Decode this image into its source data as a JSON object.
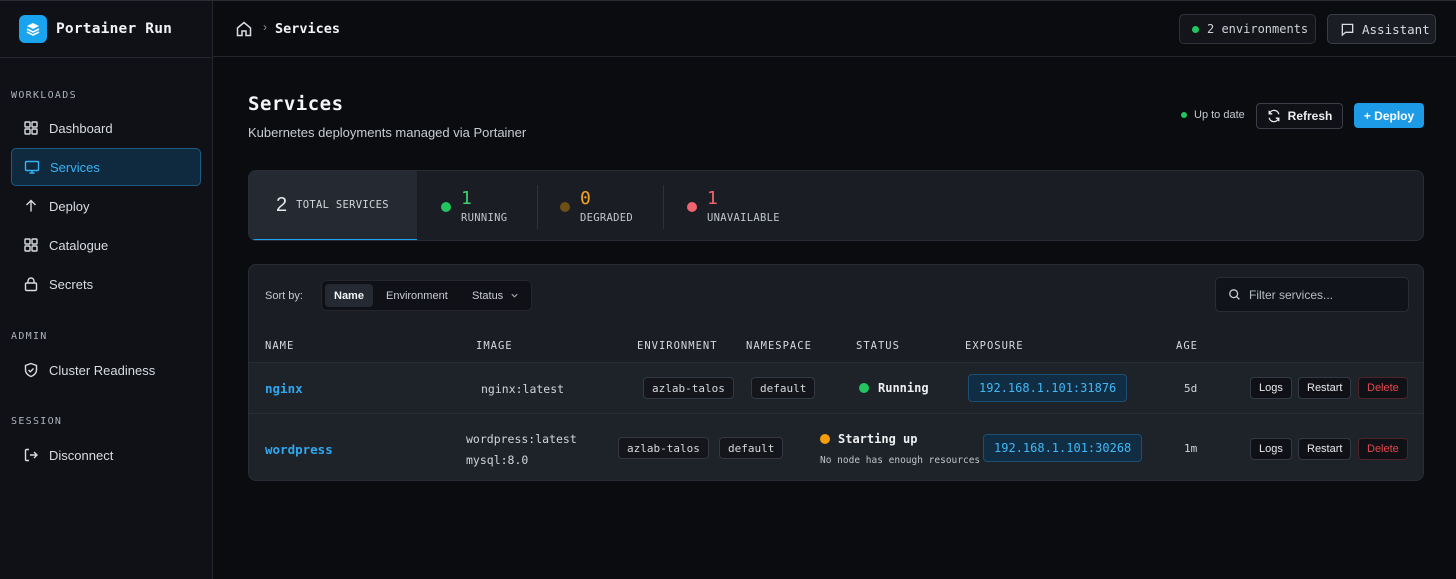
{
  "app": {
    "title": "Portainer Run"
  },
  "sidebar": {
    "sections": [
      {
        "label": "WORKLOADS"
      },
      {
        "label": "ADMIN"
      },
      {
        "label": "SESSION"
      }
    ],
    "items": [
      {
        "label": "Dashboard",
        "icon": "grid-icon",
        "active": false
      },
      {
        "label": "Services",
        "icon": "monitor-icon",
        "active": true
      },
      {
        "label": "Deploy",
        "icon": "arrow-up-icon",
        "active": false
      },
      {
        "label": "Catalogue",
        "icon": "grid-icon",
        "active": false
      },
      {
        "label": "Secrets",
        "icon": "lock-icon",
        "active": false
      },
      {
        "label": "Cluster Readiness",
        "icon": "shield-icon",
        "active": false
      },
      {
        "label": "Disconnect",
        "icon": "logout-icon",
        "active": false
      }
    ]
  },
  "topbar": {
    "breadcrumb_current": "Services",
    "environments_label": "2 environments",
    "assistant_label": "Assistant"
  },
  "header": {
    "title": "Services",
    "subtitle": "Kubernetes deployments managed via Portainer",
    "sync_status": "Up to date",
    "refresh_label": "Refresh",
    "deploy_label": "+ Deploy"
  },
  "stats": {
    "total": {
      "value": "2",
      "label": "TOTAL SERVICES"
    },
    "running": {
      "value": "1",
      "label": "RUNNING",
      "color": "#3ecf6e"
    },
    "degraded": {
      "value": "0",
      "label": "DEGRADED",
      "color": "#f5a524"
    },
    "unavailable": {
      "value": "1",
      "label": "UNAVAILABLE",
      "color": "#f06470"
    }
  },
  "toolbar": {
    "sort_label": "Sort by:",
    "sort_options": [
      "Name",
      "Environment",
      "Status"
    ],
    "filter_placeholder": "Filter services..."
  },
  "table": {
    "columns": [
      "NAME",
      "IMAGE",
      "ENVIRONMENT",
      "NAMESPACE",
      "STATUS",
      "EXPOSURE",
      "AGE"
    ],
    "rows": [
      {
        "name": "nginx",
        "images": [
          "nginx:latest"
        ],
        "environment": "azlab-talos",
        "namespace": "default",
        "status": "Running",
        "status_detail": "",
        "status_color": "#22c55e",
        "exposure": "192.168.1.101:31876",
        "age": "5d",
        "actions": [
          "Logs",
          "Restart",
          "Delete"
        ]
      },
      {
        "name": "wordpress",
        "images": [
          "wordpress:latest",
          "mysql:8.0"
        ],
        "environment": "azlab-talos",
        "namespace": "default",
        "status": "Starting up",
        "status_detail": "No node has enough resources",
        "status_color": "#f59e0b",
        "exposure": "192.168.1.101:30268",
        "age": "1m",
        "actions": [
          "Logs",
          "Restart",
          "Delete"
        ]
      }
    ]
  }
}
